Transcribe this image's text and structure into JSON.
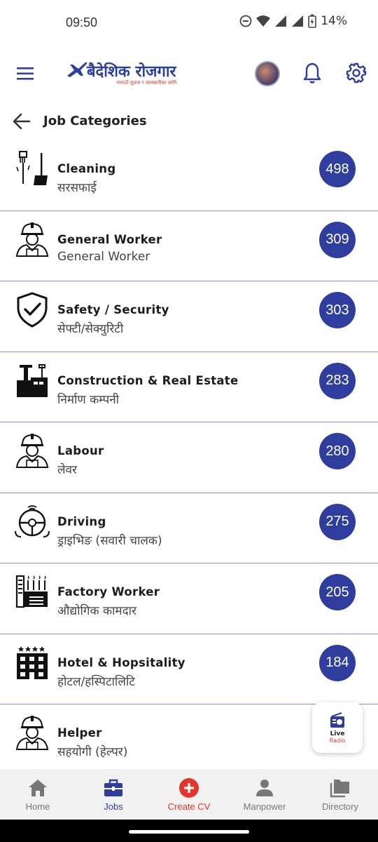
{
  "status_bar": {
    "time": "09:50",
    "battery": "14%"
  },
  "header": {
    "logo_text": "बैदेशिक रोजगार",
    "logo_tagline": "भरपर्दो सूचना र जानकारीका लागि"
  },
  "page": {
    "title": "Job Categories"
  },
  "categories": [
    {
      "name": "Cleaning",
      "subtitle": "सरसफाई",
      "count": "498",
      "icon": "cleaning-icon"
    },
    {
      "name": "General Worker",
      "subtitle": "General Worker",
      "count": "309",
      "icon": "worker-icon"
    },
    {
      "name": "Safety / Security",
      "subtitle": "सेफ्टी/सेक्युरिटी",
      "count": "303",
      "icon": "shield-icon"
    },
    {
      "name": "Construction & Real Estate",
      "subtitle": "निर्माण कम्पनी",
      "count": "283",
      "icon": "construction-icon"
    },
    {
      "name": "Labour",
      "subtitle": "लेवर",
      "count": "280",
      "icon": "worker-icon"
    },
    {
      "name": "Driving",
      "subtitle": "ड्राइभिङ (सवारी चालक)",
      "count": "275",
      "icon": "steering-wheel-icon"
    },
    {
      "name": "Factory Worker",
      "subtitle": "औद्योगिक कामदार",
      "count": "205",
      "icon": "factory-icon"
    },
    {
      "name": "Hotel & Hopsitality",
      "subtitle": "होटल/हस्पिटालिटि",
      "count": "184",
      "icon": "hotel-icon"
    },
    {
      "name": "Helper",
      "subtitle": "सहयोगी (हेल्पर)",
      "count": "",
      "icon": "worker-icon"
    }
  ],
  "live_radio": {
    "line1": "Live",
    "line2": "Radio"
  },
  "bottom_nav": [
    {
      "label": "Home",
      "icon": "home-icon"
    },
    {
      "label": "Jobs",
      "icon": "briefcase-icon"
    },
    {
      "label": "Create CV",
      "icon": "plus-circle-icon"
    },
    {
      "label": "Manpower",
      "icon": "person-icon"
    },
    {
      "label": "Directory",
      "icon": "folders-icon"
    }
  ],
  "colors": {
    "accent": "#2f3e9e",
    "create": "#e4342b",
    "divider": "#8790c7"
  }
}
